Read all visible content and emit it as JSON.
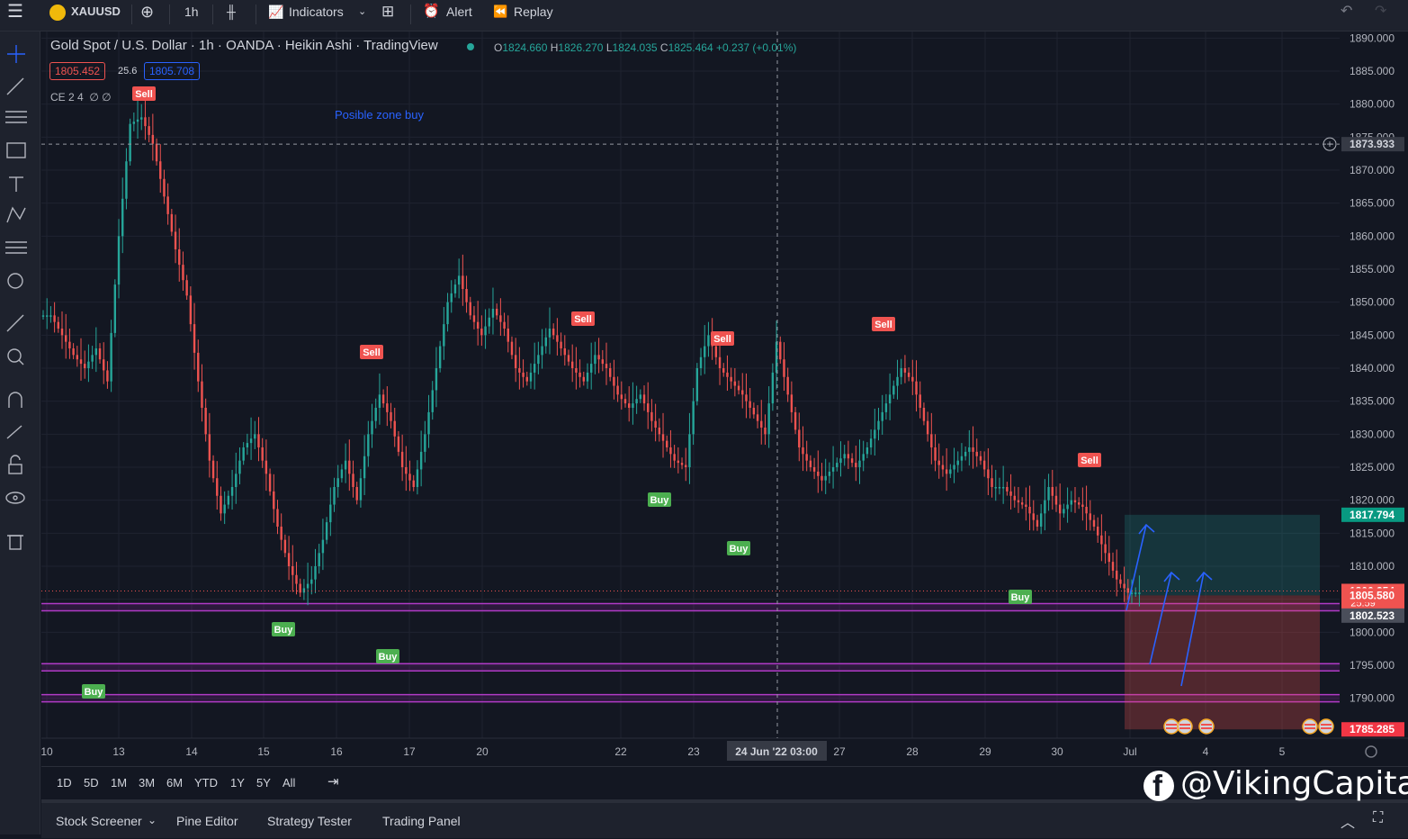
{
  "topbar": {
    "symbol": "XAUUSD",
    "interval": "1h",
    "indicators_label": "Indicators",
    "alert_label": "Alert",
    "replay_label": "Replay"
  },
  "legend": {
    "title": "Gold Spot / U.S. Dollar · 1h · OANDA · Heikin Ashi · TradingView",
    "open_key": "O",
    "open": "1824.660",
    "high_key": "H",
    "high": "1826.270",
    "low_key": "L",
    "low": "1824.035",
    "close_key": "C",
    "close": "1825.464",
    "change": "+0.237 (+0.01%)",
    "sell_price": "1805.452",
    "spread": "25.6",
    "buy_price": "1805.708",
    "indicator": "CE 2 4  ∅ ∅"
  },
  "annotation": {
    "text": "Posible zone buy",
    "color": "#2962ff"
  },
  "price_axis": {
    "ticks": [
      "1890.000",
      "1885.000",
      "1880.000",
      "1875.000",
      "1870.000",
      "1865.000",
      "1860.000",
      "1855.000",
      "1850.000",
      "1845.000",
      "1840.000",
      "1835.000",
      "1830.000",
      "1825.000",
      "1820.000",
      "1815.000",
      "1810.000",
      "1805.000",
      "1800.000",
      "1795.000",
      "1790.000"
    ],
    "crosshair_price": "1873.933",
    "target_price": "1817.794",
    "current_price": "1806.254",
    "countdown": "25:59",
    "entry_price": "1805.580",
    "level_price": "1802.523",
    "stop_price": "1785.285"
  },
  "time_axis": {
    "labels": [
      "10",
      "13",
      "14",
      "15",
      "16",
      "17",
      "20",
      "22",
      "23",
      "27",
      "28",
      "29",
      "30",
      "Jul",
      "4",
      "5"
    ],
    "crosshair_label": "24 Jun '22   03:00"
  },
  "signals": {
    "sell_label": "Sell",
    "buy_label": "Buy"
  },
  "timeframes": [
    "1D",
    "5D",
    "1M",
    "3M",
    "6M",
    "YTD",
    "1Y",
    "5Y",
    "All"
  ],
  "bottom_tabs": {
    "stock_screener": "Stock Screener",
    "pine_editor": "Pine Editor",
    "strategy_tester": "Strategy Tester",
    "trading_panel": "Trading Panel"
  },
  "watermark": "@VikingCapital",
  "colors": {
    "up": "#26a69a",
    "down": "#ef5350",
    "zone_line": "#9c27b0",
    "background": "#131722"
  },
  "chart_data": {
    "type": "candlestick",
    "style": "Heikin Ashi",
    "ylim": [
      1783,
      1891
    ],
    "close_series_approx": [
      1848,
      1845,
      1842,
      1840,
      1843,
      1838,
      1860,
      1877,
      1878,
      1874,
      1866,
      1858,
      1851,
      1838,
      1826,
      1818,
      1822,
      1828,
      1830,
      1824,
      1816,
      1810,
      1806,
      1808,
      1814,
      1822,
      1826,
      1820,
      1830,
      1836,
      1832,
      1825,
      1822,
      1830,
      1840,
      1850,
      1854,
      1848,
      1845,
      1849,
      1846,
      1840,
      1838,
      1842,
      1846,
      1843,
      1840,
      1838,
      1842,
      1840,
      1836,
      1834,
      1836,
      1832,
      1829,
      1826,
      1825,
      1840,
      1845,
      1840,
      1838,
      1836,
      1833,
      1830,
      1844,
      1836,
      1828,
      1825,
      1823,
      1825,
      1827,
      1825,
      1828,
      1832,
      1836,
      1840,
      1838,
      1832,
      1826,
      1824,
      1826,
      1828,
      1826,
      1822,
      1822,
      1820,
      1819,
      1816,
      1822,
      1818,
      1820,
      1819,
      1816,
      1812,
      1808,
      1806,
      1806
    ]
  }
}
